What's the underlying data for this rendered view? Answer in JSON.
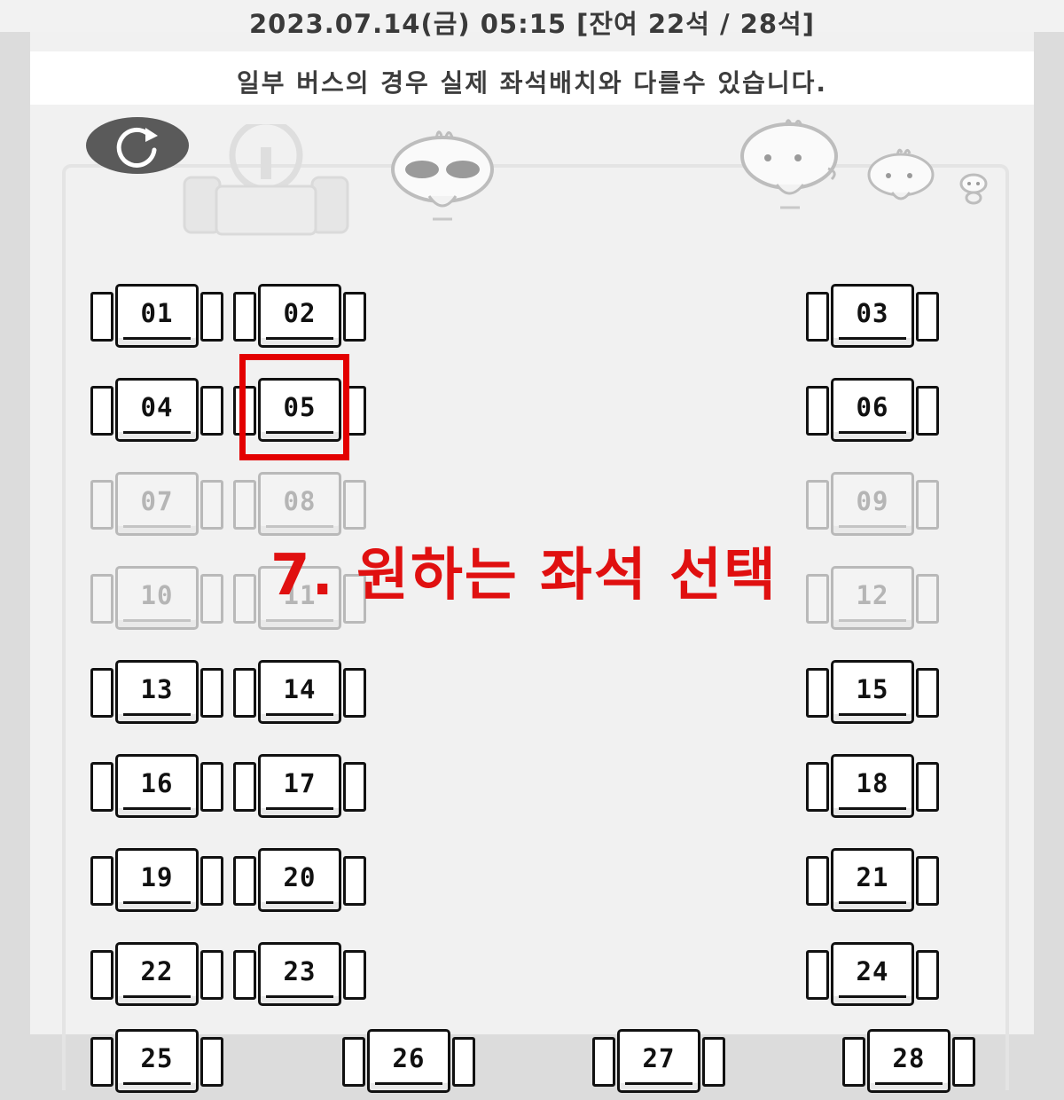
{
  "header": {
    "date_info": "2023.07.14(금) 05:15 [잔여 22석 / 28석]",
    "notice": "일부 버스의 경우 실제 좌석배치와 다를수 있습니다."
  },
  "refresh": {
    "icon": "refresh-icon"
  },
  "instruction": "7. 원하는 좌석 선택",
  "colors": {
    "highlight": "#e30000",
    "instruction": "#e01010",
    "refresh_bg": "#5a5a5a"
  },
  "seats": [
    {
      "label": "01",
      "status": "available"
    },
    {
      "label": "02",
      "status": "available"
    },
    {
      "label": "03",
      "status": "available"
    },
    {
      "label": "04",
      "status": "available"
    },
    {
      "label": "05",
      "status": "available",
      "selected": true
    },
    {
      "label": "06",
      "status": "available"
    },
    {
      "label": "07",
      "status": "taken"
    },
    {
      "label": "08",
      "status": "taken"
    },
    {
      "label": "09",
      "status": "taken"
    },
    {
      "label": "10",
      "status": "taken"
    },
    {
      "label": "11",
      "status": "taken"
    },
    {
      "label": "12",
      "status": "taken"
    },
    {
      "label": "13",
      "status": "available"
    },
    {
      "label": "14",
      "status": "available"
    },
    {
      "label": "15",
      "status": "available"
    },
    {
      "label": "16",
      "status": "available"
    },
    {
      "label": "17",
      "status": "available"
    },
    {
      "label": "18",
      "status": "available"
    },
    {
      "label": "19",
      "status": "available"
    },
    {
      "label": "20",
      "status": "available"
    },
    {
      "label": "21",
      "status": "available"
    },
    {
      "label": "22",
      "status": "available"
    },
    {
      "label": "23",
      "status": "available"
    },
    {
      "label": "24",
      "status": "available"
    },
    {
      "label": "25",
      "status": "available"
    },
    {
      "label": "26",
      "status": "available"
    },
    {
      "label": "27",
      "status": "available"
    },
    {
      "label": "28",
      "status": "available"
    }
  ]
}
